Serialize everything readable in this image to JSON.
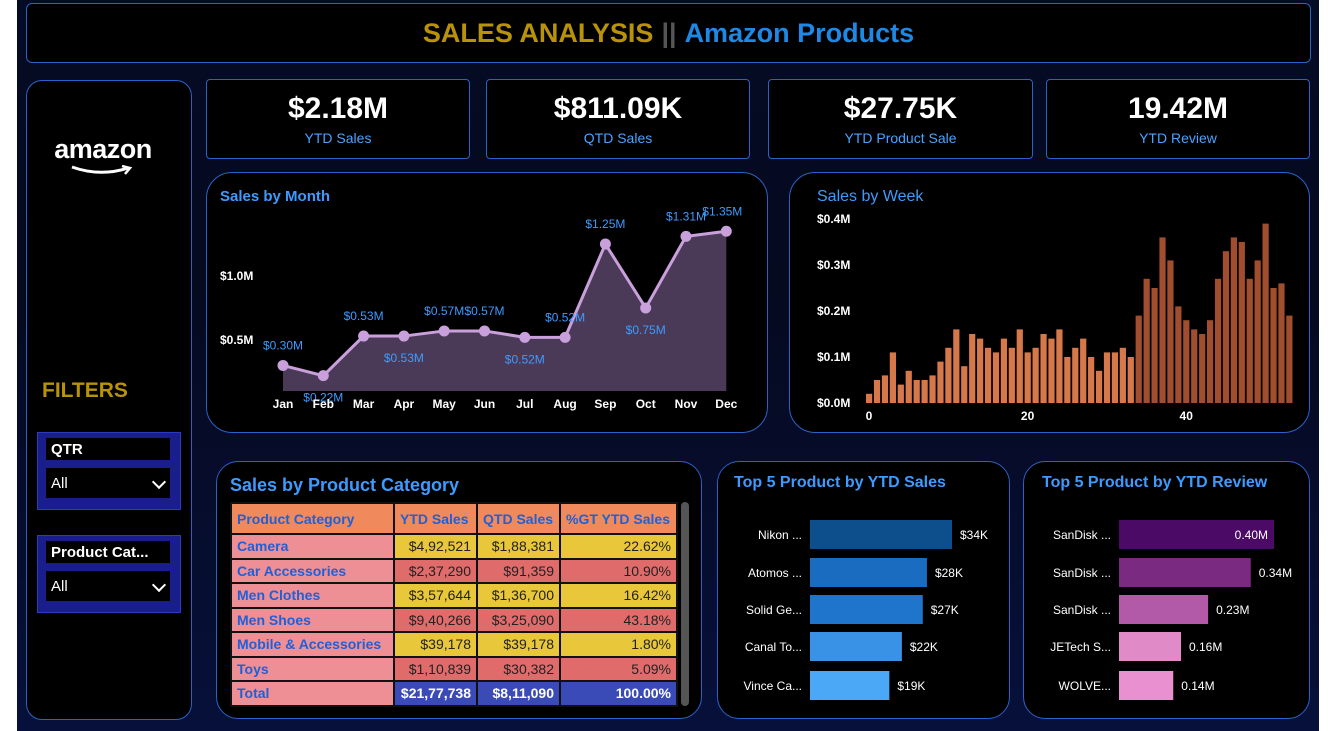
{
  "header": {
    "title_main": "SALES ANALYSIS",
    "title_sep": "||",
    "title_sub": "Amazon Products"
  },
  "sidebar": {
    "logo_text": "amazon",
    "filters_label": "FILTERS",
    "slicers": [
      {
        "label": "QTR",
        "value": "All"
      },
      {
        "label": "Product Cat...",
        "value": "All"
      }
    ]
  },
  "kpis": [
    {
      "value": "$2.18M",
      "label": "YTD Sales"
    },
    {
      "value": "$811.09K",
      "label": "QTD Sales"
    },
    {
      "value": "$27.75K",
      "label": "YTD Product Sale"
    },
    {
      "value": "19.42M",
      "label": "YTD Review"
    }
  ],
  "colors": {
    "accent": "#3d9bff",
    "gold": "#b8930a",
    "line": "#c9a0dc",
    "area": "#4b3a57"
  },
  "chart_data": [
    {
      "id": "sales_by_month",
      "type": "area",
      "title": "Sales by Month",
      "categories": [
        "Jan",
        "Feb",
        "Mar",
        "Apr",
        "May",
        "Jun",
        "Jul",
        "Aug",
        "Sep",
        "Oct",
        "Nov",
        "Dec"
      ],
      "values": [
        0.3,
        0.22,
        0.53,
        0.53,
        0.57,
        0.57,
        0.52,
        0.52,
        1.25,
        0.75,
        1.31,
        1.35
      ],
      "data_labels": [
        "$0.30M",
        "$0.22M",
        "$0.53M",
        "$0.53M",
        "$0.57M",
        "$0.57M",
        "$0.52M",
        "$0.52M",
        "$1.25M",
        "$0.75M",
        "$1.31M",
        "$1.35M"
      ],
      "yticks": [
        {
          "value": 0.5,
          "label": "$0.5M"
        },
        {
          "value": 1.0,
          "label": "$1.0M"
        }
      ],
      "ylim": [
        0.1,
        1.5
      ]
    },
    {
      "id": "sales_by_week",
      "type": "bar",
      "title": "Sales by Week",
      "values": [
        0.02,
        0.05,
        0.06,
        0.11,
        0.04,
        0.07,
        0.05,
        0.05,
        0.06,
        0.09,
        0.12,
        0.16,
        0.08,
        0.15,
        0.14,
        0.12,
        0.11,
        0.14,
        0.12,
        0.16,
        0.11,
        0.12,
        0.15,
        0.14,
        0.16,
        0.1,
        0.12,
        0.14,
        0.1,
        0.07,
        0.11,
        0.11,
        0.12,
        0.1,
        0.19,
        0.27,
        0.25,
        0.36,
        0.31,
        0.21,
        0.18,
        0.16,
        0.15,
        0.18,
        0.27,
        0.33,
        0.36,
        0.35,
        0.27,
        0.31,
        0.39,
        0.25,
        0.26,
        0.19
      ],
      "xticks": [
        0,
        20,
        40
      ],
      "yticks": [
        {
          "value": 0,
          "label": "$0.0M"
        },
        {
          "value": 0.1,
          "label": "$0.1M"
        },
        {
          "value": 0.2,
          "label": "$0.2M"
        },
        {
          "value": 0.3,
          "label": "$0.3M"
        },
        {
          "value": 0.4,
          "label": "$0.4M"
        }
      ],
      "ylim": [
        0,
        0.4
      ]
    },
    {
      "id": "sales_by_product_category",
      "type": "table",
      "title": "Sales by Product Category",
      "columns": [
        "Product Category",
        "YTD Sales",
        "QTD Sales",
        "%GT YTD Sales"
      ],
      "rows": [
        [
          "Camera",
          "$4,92,521",
          "$1,88,381",
          "22.62%"
        ],
        [
          "Car Accessories",
          "$2,37,290",
          "$91,359",
          "10.90%"
        ],
        [
          "Men Clothes",
          "$3,57,644",
          "$1,36,700",
          "16.42%"
        ],
        [
          "Men Shoes",
          "$9,40,266",
          "$3,25,090",
          "43.18%"
        ],
        [
          "Mobile & Accessories",
          "$39,178",
          "$39,178",
          "1.80%"
        ],
        [
          "Toys",
          "$1,10,839",
          "$30,382",
          "5.09%"
        ]
      ],
      "total": [
        "Total",
        "$21,77,738",
        "$8,11,090",
        "100.00%"
      ]
    },
    {
      "id": "top5_ytd_sales",
      "type": "bar",
      "title": "Top 5 Product by YTD Sales",
      "categories": [
        "Nikon ...",
        "Atomos ...",
        "Solid Ge...",
        "Canal To...",
        "Vince Ca..."
      ],
      "values": [
        34,
        28,
        27,
        22,
        19
      ],
      "data_labels": [
        "$34K",
        "$28K",
        "$27K",
        "$22K",
        "$19K"
      ],
      "colors": [
        "#0d4f8c",
        "#1a6cc0",
        "#1f74cc",
        "#3a92e6",
        "#4aa8f6"
      ]
    },
    {
      "id": "top5_ytd_review",
      "type": "bar",
      "title": "Top 5 Product by YTD Review",
      "categories": [
        "SanDisk ...",
        "SanDisk ...",
        "SanDisk ...",
        "JETech S...",
        "WOLVE..."
      ],
      "values": [
        0.4,
        0.34,
        0.23,
        0.16,
        0.14
      ],
      "data_labels": [
        "0.40M",
        "0.34M",
        "0.23M",
        "0.16M",
        "0.14M"
      ],
      "colors": [
        "#4a0a66",
        "#7a2a80",
        "#b25aa8",
        "#e08bc8",
        "#e890d0"
      ]
    }
  ]
}
